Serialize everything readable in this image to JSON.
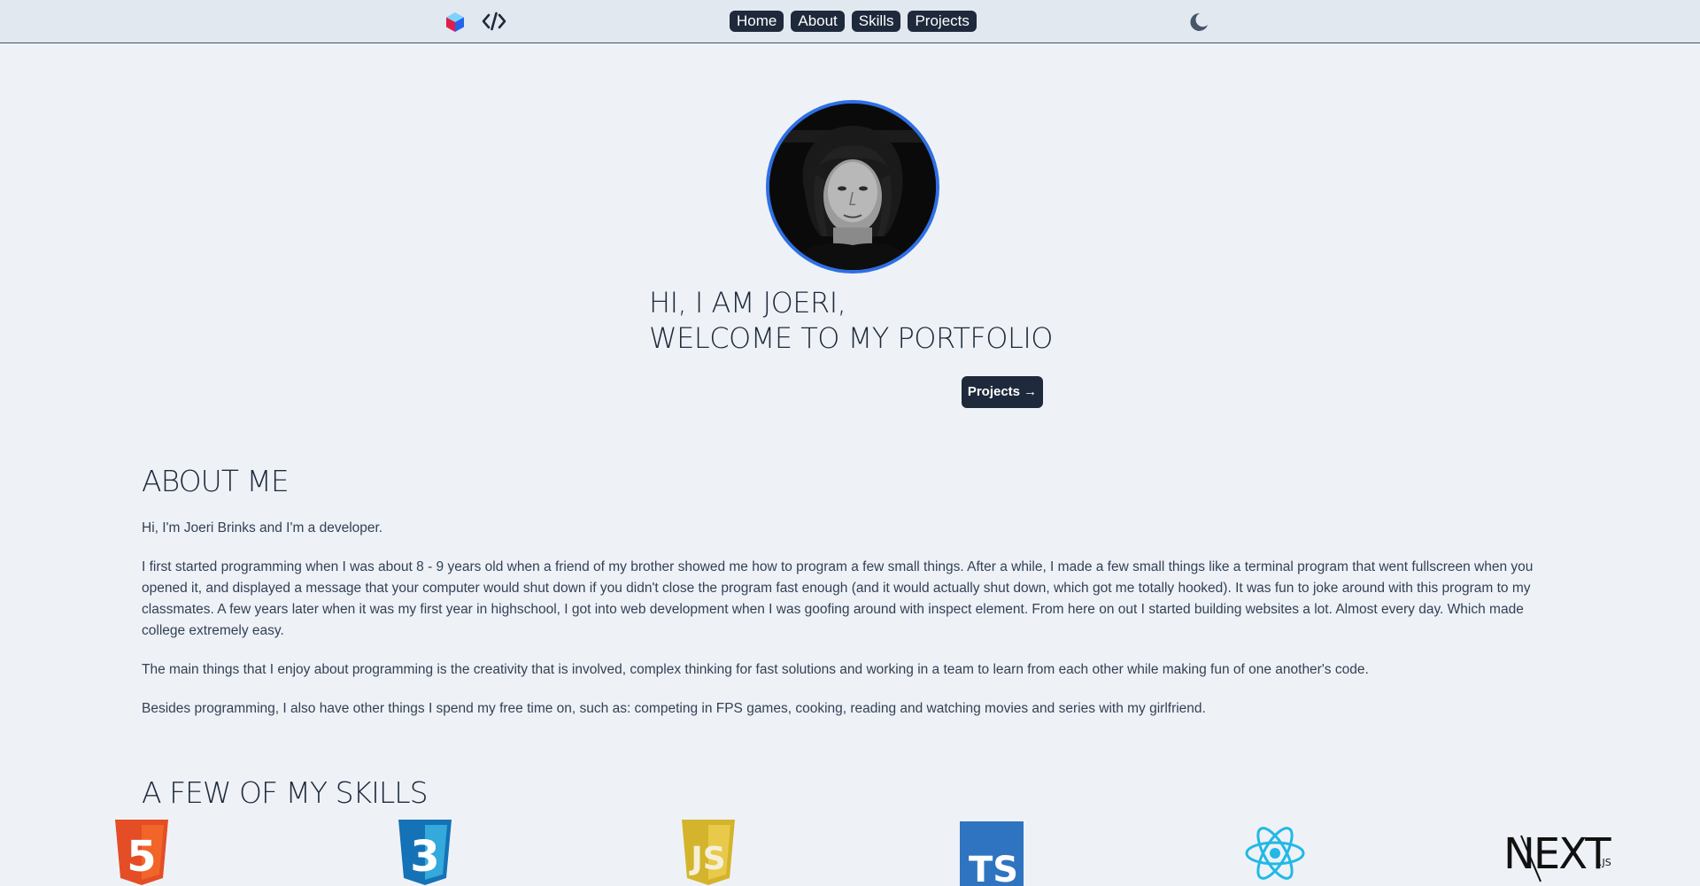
{
  "nav": {
    "brand_icon": "cube-logo-icon",
    "code_icon": "code-brackets-icon",
    "links": [
      "Home",
      "About",
      "Skills",
      "Projects"
    ],
    "theme_icon": "moon-icon"
  },
  "hero": {
    "avatar_icon": "profile-photo",
    "title_line1": "HI, I AM JOERI,",
    "title_line2": "WELCOME TO MY PORTFOLIO",
    "cta_label": "Projects →"
  },
  "about": {
    "title": "ABOUT ME",
    "paragraphs": [
      "Hi, I'm Joeri Brinks and I'm a developer.",
      "I first started programming when I was about 8 - 9 years old when a friend of my brother showed me how to program a few small things. After a while, I made a few small things like a terminal program that went fullscreen when you opened it, and displayed a message that your computer would shut down if you didn't close the program fast enough (and it would actually shut down, which got me totally hooked). It was fun to joke around with this program to my classmates. A few years later when it was my first year in highschool, I got into web development when I was goofing around with inspect element. From here on out I started building websites a lot. Almost every day. Which made college extremely easy.",
      "The main things that I enjoy about programming is the creativity that is involved, complex thinking for fast solutions and working in a team to learn from each other while making fun of one another's code.",
      "Besides programming, I also have other things I spend my free time on, such as: competing in FPS games, cooking, reading and watching movies and series with my girlfriend."
    ]
  },
  "skills": {
    "title": "A FEW OF MY SKILLS",
    "items": [
      {
        "icon": "html5-icon",
        "text": "5",
        "color": "#e44d26"
      },
      {
        "icon": "css3-icon",
        "text": "3",
        "color": "#1572b6"
      },
      {
        "icon": "javascript-icon",
        "text": "JS",
        "color": "#d4b42c"
      },
      {
        "icon": "typescript-icon",
        "text": "TS",
        "color": "#2f74c0"
      },
      {
        "icon": "react-icon",
        "color": "#22b8e6"
      },
      {
        "icon": "nextjs-icon",
        "text": "NEXT",
        "subtext": ".JS",
        "color": "#111111"
      }
    ]
  }
}
